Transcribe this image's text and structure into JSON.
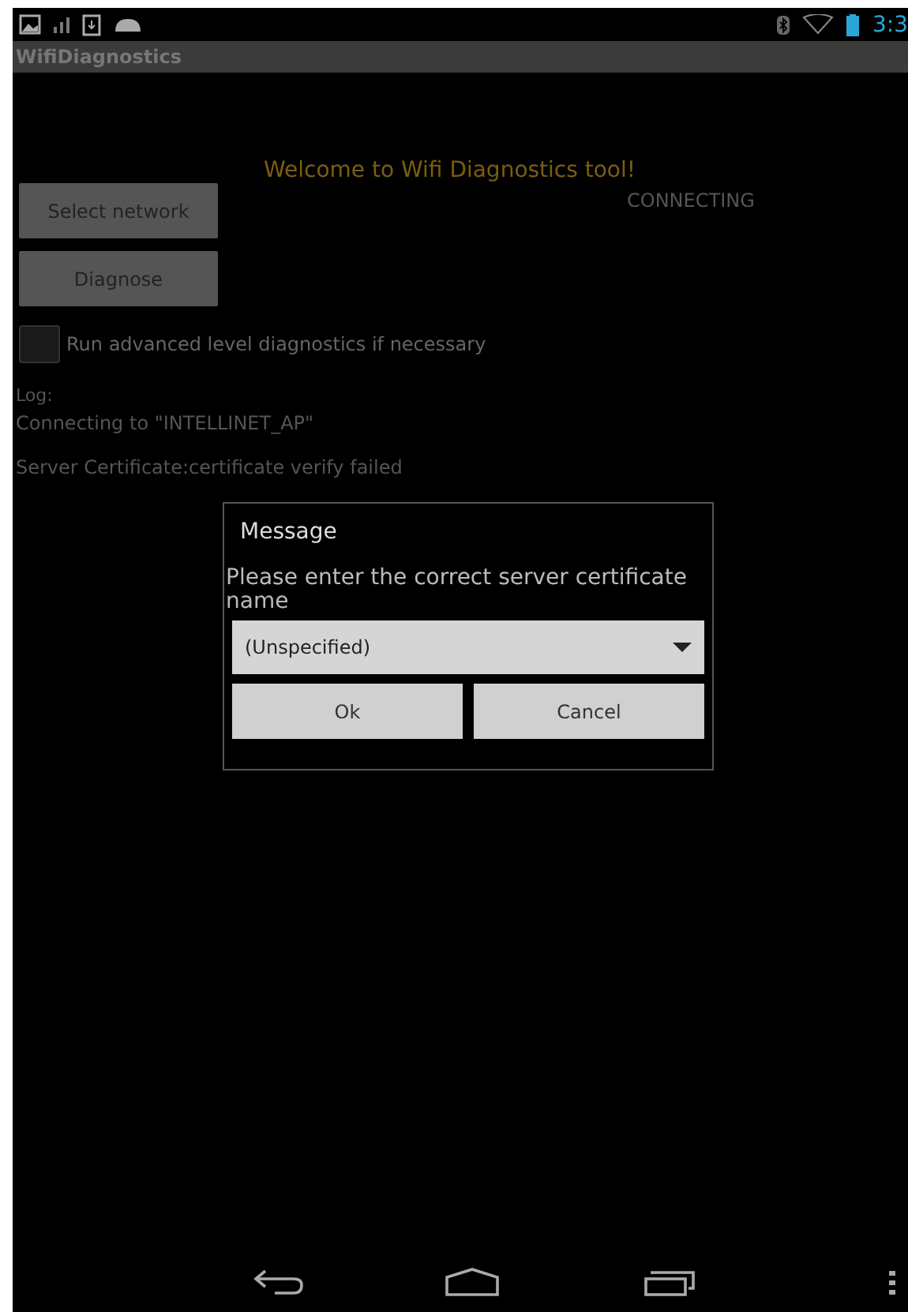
{
  "status_bar": {
    "time": "3:3"
  },
  "action_bar": {
    "title": "WifiDiagnostics"
  },
  "welcome": "Welcome to Wifi Diagnostics tool!",
  "status": "CONNECTING",
  "buttons": [
    "Select network",
    "Diagnose"
  ],
  "advanced": {
    "label": "Run advanced level diagnostics if necessary",
    "checked": false
  },
  "log": {
    "label": "Log:",
    "lines": [
      "Connecting to \"INTELLINET_AP\"",
      "Server Certificate:certificate verify failed"
    ]
  },
  "dialog": {
    "title": "Message",
    "message": "Please enter the correct server certificate name",
    "dropdown": {
      "value": "(Unspecified)"
    },
    "buttons": [
      "Ok",
      "Cancel"
    ]
  }
}
